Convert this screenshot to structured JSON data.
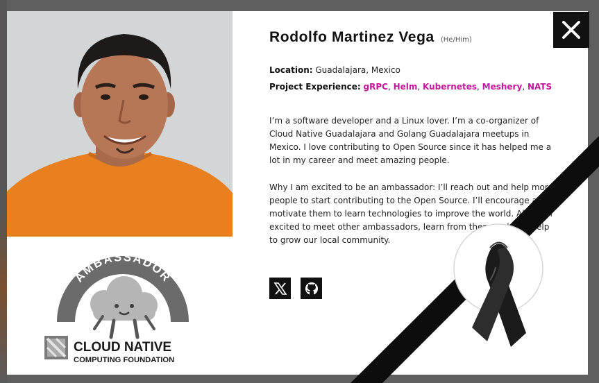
{
  "profile": {
    "name": "Rodolfo Martinez Vega",
    "pronouns": "(He/Him)",
    "location_label": "Location:",
    "location_value": "Guadalajara, Mexico",
    "projects_label": "Project Experience:",
    "projects": [
      "gRPC",
      "Helm",
      "Kubernetes",
      "Meshery",
      "NATS"
    ],
    "bio_paragraphs": [
      "I’m a software developer and a Linux lover. I’m a co-organizer of Cloud Native Guadalajara and Golang Guadalajara meetups in Mexico. I love contributing to Open Source since it has helped me a lot in my career and meet amazing people.",
      "Why I am excited to be an ambassador: I’ll reach out and help more people to start contributing to the Open Source. I’ll encourage and motivate them to learn technologies to improve the world. Also, I’m excited to meet other ambassadors, learn from them and also help to grow our local community."
    ]
  },
  "badge": {
    "arc_text": "AMBASSADOR",
    "org_line1": "CLOUD NATIVE",
    "org_line2": "COMPUTING FOUNDATION"
  },
  "social_links": [
    {
      "icon": "x-twitter-icon"
    },
    {
      "icon": "github-icon"
    }
  ],
  "icons": {
    "close": "close-icon",
    "memorial": "mourning-ribbon-icon"
  },
  "colors": {
    "accent": "#c5179b",
    "shirt": "#e8801f",
    "badge_gray": "#6b6b6b",
    "ribbon": "#111111",
    "overlay": "#5f5f5f"
  }
}
